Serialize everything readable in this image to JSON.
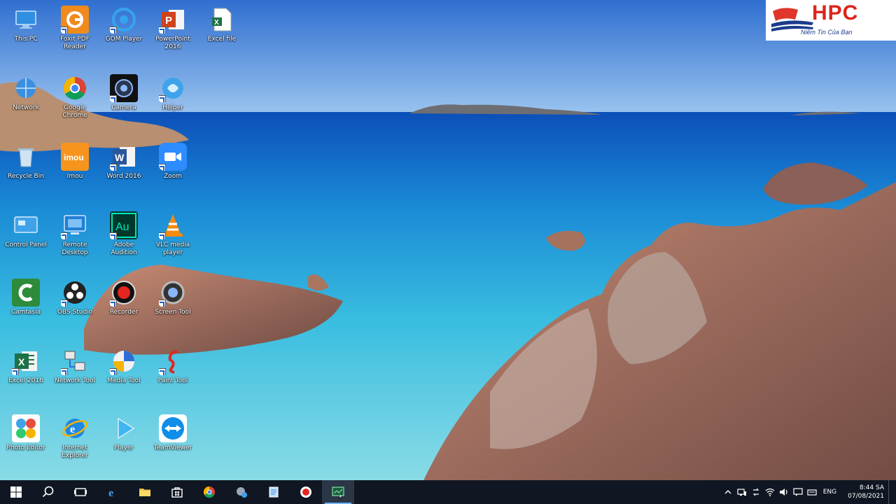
{
  "logo": {
    "brand": "HPC",
    "slogan": "Niềm Tin Của Bạn"
  },
  "desktop_icons": [
    {
      "label": "This PC",
      "icon": "this-pc-icon"
    },
    {
      "label": "Foxit PDF Reader",
      "icon": "foxit-reader-icon"
    },
    {
      "label": "GOM Player",
      "icon": "gom-player-icon"
    },
    {
      "label": "PowerPoint 2016",
      "icon": "powerpoint-icon"
    },
    {
      "label": "Excel file",
      "icon": "excel-file-icon"
    },
    {
      "label": "Network",
      "icon": "network-icon"
    },
    {
      "label": "Google Chrome",
      "icon": "chrome-icon"
    },
    {
      "label": "Camera",
      "icon": "camera-icon"
    },
    {
      "label": "Helper",
      "icon": "globe-helper-icon"
    },
    {
      "label": "Recycle Bin",
      "icon": "recycle-bin-icon"
    },
    {
      "label": "Imou",
      "icon": "imou-icon"
    },
    {
      "label": "Word 2016",
      "icon": "word-icon"
    },
    {
      "label": "Zoom",
      "icon": "zoom-icon"
    },
    {
      "label": "Control Panel",
      "icon": "control-panel-icon"
    },
    {
      "label": "Remote Desktop",
      "icon": "remote-desktop-icon"
    },
    {
      "label": "Adobe Audition",
      "icon": "audition-icon"
    },
    {
      "label": "VLC media player",
      "icon": "vlc-icon"
    },
    {
      "label": "Camtasia",
      "icon": "camtasia-icon"
    },
    {
      "label": "OBS Studio",
      "icon": "obs-icon"
    },
    {
      "label": "Recorder",
      "icon": "recorder-icon"
    },
    {
      "label": "Screen Tool",
      "icon": "screen-tool-icon"
    },
    {
      "label": "Excel 2016",
      "icon": "excel-icon"
    },
    {
      "label": "Network Tool",
      "icon": "network-tool-icon"
    },
    {
      "label": "Media Tool",
      "icon": "media-tool-icon"
    },
    {
      "label": "Paint Tool",
      "icon": "paint-tool-icon"
    },
    {
      "label": "Photo Editor",
      "icon": "photo-editor-icon"
    },
    {
      "label": "Internet Explorer",
      "icon": "ie-icon"
    },
    {
      "label": "Player",
      "icon": "player-icon"
    },
    {
      "label": "TeamViewer",
      "icon": "teamviewer-icon"
    }
  ],
  "taskbar": {
    "buttons": [
      {
        "name": "start-icon"
      },
      {
        "name": "search-icon"
      },
      {
        "name": "task-view-icon"
      },
      {
        "name": "edge-icon"
      },
      {
        "name": "file-explorer-icon"
      },
      {
        "name": "store-icon"
      },
      {
        "name": "chrome-icon"
      },
      {
        "name": "app-icon"
      },
      {
        "name": "notepad-icon"
      },
      {
        "name": "recorder-icon"
      },
      {
        "name": "screen-capture-icon"
      }
    ],
    "tray": {
      "language": "ENG",
      "time": "8:44 SA",
      "date": "07/08/2021"
    }
  },
  "colors": {
    "taskbar_bg": "#101722",
    "accent": "#6fb3ff",
    "logo_red": "#d9261c",
    "logo_blue": "#1a3c8c"
  }
}
